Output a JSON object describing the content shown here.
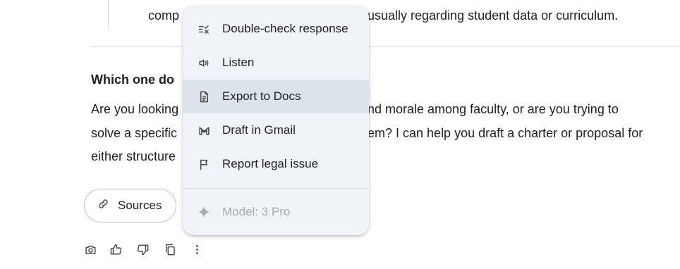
{
  "response": {
    "top_line_part1": "comp",
    "top_line_part2": "usually regarding student data or curriculum.",
    "heading": "Which one do",
    "para_line1_left": "Are you looking",
    "para_line1_right": "nd morale among faculty, or are you trying to",
    "para_line2_left": "solve a specific",
    "para_line2_right": "em? I can help you draft a charter or proposal for",
    "para_line3_left": "either structure"
  },
  "sources_chip": {
    "label": "Sources",
    "icon": "link-icon"
  },
  "action_bar": {
    "items": [
      {
        "name": "camera-icon"
      },
      {
        "name": "thumbs-up-icon"
      },
      {
        "name": "thumbs-down-icon"
      },
      {
        "name": "copy-icon"
      },
      {
        "name": "more-vert-icon"
      }
    ]
  },
  "menu": {
    "items": [
      {
        "label": "Double-check response",
        "icon": "double-check-icon"
      },
      {
        "label": "Listen",
        "icon": "speaker-icon"
      },
      {
        "label": "Export to Docs",
        "icon": "docs-icon",
        "highlighted": true
      },
      {
        "label": "Draft in Gmail",
        "icon": "gmail-icon"
      },
      {
        "label": "Report legal issue",
        "icon": "flag-icon"
      }
    ],
    "model_label": "Model: 3 Pro",
    "model_icon": "sparkle-icon"
  },
  "colors": {
    "text": "#1f1f1f",
    "menu_bg": "#f0f4f9",
    "menu_highlight": "#dde3ea",
    "muted": "#a8abaf",
    "divider": "#dadce0"
  }
}
